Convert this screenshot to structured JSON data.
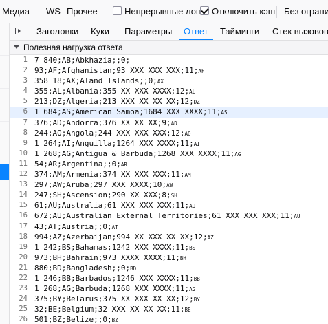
{
  "toolbar": {
    "items": [
      "Медиа",
      "WS",
      "Прочее"
    ],
    "checkboxes": [
      {
        "label": "Непрерывные логи",
        "checked": false
      },
      {
        "label": "Отключить кэш",
        "checked": true
      }
    ],
    "throttle": "Без огранич"
  },
  "tabs": [
    "Заголовки",
    "Куки",
    "Параметры",
    "Ответ",
    "Тайминги",
    "Стек вызовов"
  ],
  "active_tab": "Ответ",
  "section_title": "Полезная нагрузка ответа",
  "highlight_line": 6,
  "lines": [
    {
      "n": "1",
      "text": "7 840;AB;Abkhazia;;0;",
      "tag": ""
    },
    {
      "n": "2",
      "text": "93;AF;Afghanistan;93 XXX XXX XXX;11;",
      "tag": "AF"
    },
    {
      "n": "3",
      "text": "358 18;AX;Aland Islands;;0;",
      "tag": "AX"
    },
    {
      "n": "4",
      "text": "355;AL;Albania;355 XX XXX XXXX;12;",
      "tag": "AL"
    },
    {
      "n": "5",
      "text": "213;DZ;Algeria;213 XXX XX XX XX;12;",
      "tag": "DZ"
    },
    {
      "n": "6",
      "text": "1 684;AS;American Samoa;1684 XXX XXXX;11;",
      "tag": "AS"
    },
    {
      "n": "7",
      "text": "376;AD;Andorra;376 XX XX XX;9;",
      "tag": "AD"
    },
    {
      "n": "8",
      "text": "244;AO;Angola;244 XXX XXX XXX;12;",
      "tag": "AO"
    },
    {
      "n": "9",
      "text": "1 264;AI;Anguilla;1264 XXX XXXX;11;",
      "tag": "AI"
    },
    {
      "n": "10",
      "text": "1 268;AG;Antigua & Barbuda;1268 XXX XXXX;11;",
      "tag": "AG"
    },
    {
      "n": "11",
      "text": "54;AR;Argentina;;0;",
      "tag": "AR"
    },
    {
      "n": "12",
      "text": "374;AM;Armenia;374 XX XXX XXX;11;",
      "tag": "AM"
    },
    {
      "n": "13",
      "text": "297;AW;Aruba;297 XXX XXXX;10;",
      "tag": "AW"
    },
    {
      "n": "14",
      "text": "247;SH;Ascension;290 XX XXX;8;",
      "tag": "SH"
    },
    {
      "n": "15",
      "text": "61;AU;Australia;61 XXX XXX XXX;11;",
      "tag": "AU"
    },
    {
      "n": "16",
      "text": "672;AU;Australian External Territories;61 XXX XXX XXX;11;",
      "tag": "AU"
    },
    {
      "n": "17",
      "text": "43;AT;Austria;;0;",
      "tag": "AT"
    },
    {
      "n": "18",
      "text": "994;AZ;Azerbaijan;994 XX XXX XX XX;12;",
      "tag": "AZ"
    },
    {
      "n": "19",
      "text": "1 242;BS;Bahamas;1242 XXX XXXX;11;",
      "tag": "BS"
    },
    {
      "n": "20",
      "text": "973;BH;Bahrain;973 XXXX XXXX;11;",
      "tag": "BH"
    },
    {
      "n": "21",
      "text": "880;BD;Bangladesh;;0;",
      "tag": "BD"
    },
    {
      "n": "22",
      "text": "1 246;BB;Barbados;1246 XXX XXXX;11;",
      "tag": "BB"
    },
    {
      "n": "23",
      "text": "1 268;AG;Barbuda;1268 XXX XXXX;11;",
      "tag": "AG"
    },
    {
      "n": "24",
      "text": "375;BY;Belarus;375 XX XXX XX XX;12;",
      "tag": "BY"
    },
    {
      "n": "25",
      "text": "32;BE;Belgium;32 XXX XX XX XX;11;",
      "tag": "BE"
    },
    {
      "n": "26",
      "text": "501;BZ;Belize;;0;",
      "tag": "BZ"
    }
  ]
}
